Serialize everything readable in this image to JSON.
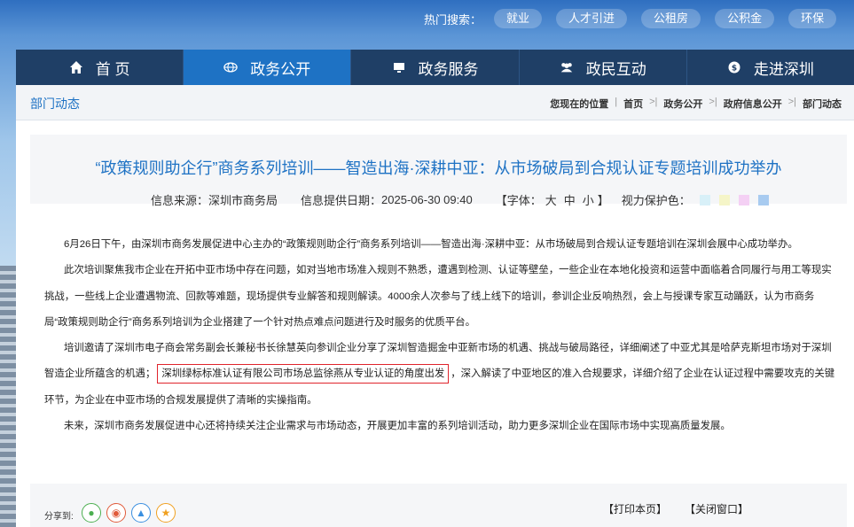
{
  "hot_search": {
    "label": "热门搜索：",
    "tags": [
      "就业",
      "人才引进",
      "公租房",
      "公积金",
      "环保"
    ]
  },
  "nav": [
    {
      "label": "首 页",
      "icon": "home-icon"
    },
    {
      "label": "政务公开",
      "icon": "globe-icon"
    },
    {
      "label": "政务服务",
      "icon": "monitor-icon"
    },
    {
      "label": "政民互动",
      "icon": "people-icon"
    },
    {
      "label": "走进深圳",
      "icon": "info-icon"
    }
  ],
  "section_title": "部门动态",
  "breadcrumb": {
    "prefix": "您现在的位置",
    "items": [
      "首页",
      "政务公开",
      "政府信息公开",
      "部门动态"
    ],
    "arrow": ">"
  },
  "article": {
    "title": "“政策规则助企行”商务系列培训——智造出海·深耕中亚：从市场破局到合规认证专题培训成功举办",
    "source_label": "信息来源：",
    "source": "深圳市商务局",
    "date_label": "信息提供日期：",
    "date": "2025-06-30 09:40",
    "font_label": "【字体：",
    "font_sizes": [
      "大",
      "中",
      "小"
    ],
    "font_close": "】",
    "eye_label": "视力保护色：",
    "eye_colors": [
      "#d8f0f8",
      "#f5f5c8",
      "#f4d0f4",
      "#a8cbf0"
    ],
    "paragraphs": {
      "p1": "6月26日下午，由深圳市商务发展促进中心主办的“政策规则助企行”商务系列培训——智造出海·深耕中亚：从市场破局到合规认证专题培训在深圳会展中心成功举办。",
      "p2": "此次培训聚焦我市企业在开拓中亚市场中存在问题，如对当地市场准入规则不熟悉，遭遇到检测、认证等壁垒，一些企业在本地化投资和运营中面临着合同履行与用工等现实挑战，一些线上企业遭遇物流、回款等难题，现场提供专业解答和规则解读。4000余人次参与了线上线下的培训，参训企业反响热烈，会上与授课专家互动踊跃，认为市商务局“政策规则助企行”商务系列培训为企业搭建了一个针对热点难点问题进行及时服务的优质平台。",
      "p3_a": "培训邀请了深圳市电子商会常务副会长兼秘书长徐慧英向参训企业分享了深圳智造掘金中亚新市场的机遇、挑战与破局路径，详细阐述了中亚尤其是哈萨克斯坦市场对于深圳智造企业所蕴含的机遇；",
      "p3_highlight": "深圳绿标标准认证有限公司市场总监徐燕从专业认证的角度出发",
      "p3_b": "，深入解读了中亚地区的准入合规要求，详细介绍了企业在认证过程中需要攻克的关键环节，为企业在中亚市场的合规发展提供了清晰的实操指南。",
      "p4": "未来，深圳市商务发展促进中心还将持续关注企业需求与市场动态，开展更加丰富的系列培训活动，助力更多深圳企业在国际市场中实现高质量发展。"
    }
  },
  "footer": {
    "share_label": "分享到:",
    "share_icons": [
      "wechat-icon",
      "weibo-icon",
      "qq-icon",
      "favorite-icon"
    ],
    "print": "【打印本页】",
    "close": "【关闭窗口】"
  }
}
